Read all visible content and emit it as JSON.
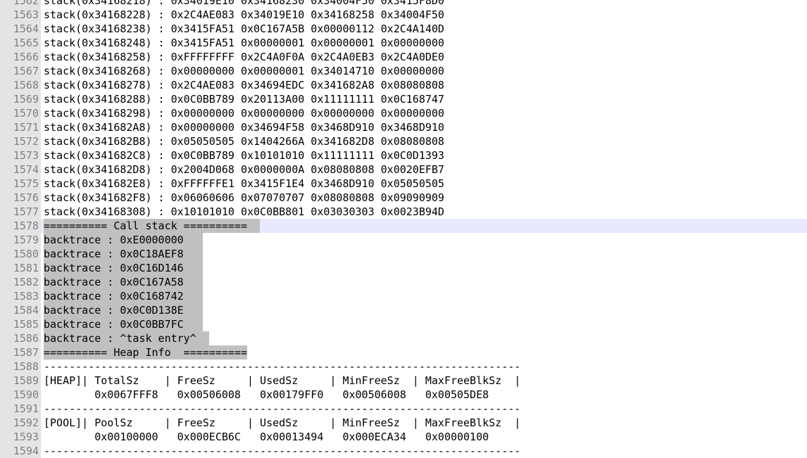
{
  "editor": {
    "current_line": 1578,
    "lines": [
      {
        "num": "1562",
        "text": "stack(0x34168218) : 0x34019E10 0x34168230 0x34004F50 0x3415F8D0",
        "selected": false
      },
      {
        "num": "1563",
        "text": "stack(0x34168228) : 0x2C4AE083 0x34019E10 0x34168258 0x34004F50",
        "selected": false
      },
      {
        "num": "1564",
        "text": "stack(0x34168238) : 0x3415FA51 0x0C167A5B 0x00000112 0x2C4A140D",
        "selected": false
      },
      {
        "num": "1565",
        "text": "stack(0x34168248) : 0x3415FA51 0x00000001 0x00000001 0x00000000",
        "selected": false
      },
      {
        "num": "1566",
        "text": "stack(0x34168258) : 0xFFFFFFFF 0x2C4A0F0A 0x2C4A0EB3 0x2C4A0DE0",
        "selected": false
      },
      {
        "num": "1567",
        "text": "stack(0x34168268) : 0x00000000 0x00000001 0x34014710 0x00000000",
        "selected": false
      },
      {
        "num": "1568",
        "text": "stack(0x34168278) : 0x2C4AE083 0x34694EDC 0x341682A8 0x08080808",
        "selected": false
      },
      {
        "num": "1569",
        "text": "stack(0x34168288) : 0x0C0BB789 0x20113A00 0x11111111 0x0C168747",
        "selected": false
      },
      {
        "num": "1570",
        "text": "stack(0x34168298) : 0x00000000 0x00000000 0x00000000 0x00000000",
        "selected": false
      },
      {
        "num": "1571",
        "text": "stack(0x341682A8) : 0x00000000 0x34694F58 0x3468D910 0x3468D910",
        "selected": false
      },
      {
        "num": "1572",
        "text": "stack(0x341682B8) : 0x05050505 0x1404266A 0x341682D8 0x08080808",
        "selected": false
      },
      {
        "num": "1573",
        "text": "stack(0x341682C8) : 0x0C0BB789 0x10101010 0x11111111 0x0C0D1393",
        "selected": false
      },
      {
        "num": "1574",
        "text": "stack(0x341682D8) : 0x2004D068 0x0000000A 0x08080808 0x0020EFB7",
        "selected": false
      },
      {
        "num": "1575",
        "text": "stack(0x341682E8) : 0xFFFFFFE1 0x3415F1E4 0x3468D910 0x05050505",
        "selected": false
      },
      {
        "num": "1576",
        "text": "stack(0x341682F8) : 0x06060606 0x07070707 0x08080808 0x09090909",
        "selected": false
      },
      {
        "num": "1577",
        "text": "stack(0x34168308) : 0x10101010 0x0C0BB801 0x03030303 0x0023B94D",
        "selected": false
      },
      {
        "num": "1578",
        "text": "========== Call stack ==========  ",
        "selected": true
      },
      {
        "num": "1579",
        "text": "backtrace : 0xE0000000   ",
        "selected": true
      },
      {
        "num": "1580",
        "text": "backtrace : 0x0C18AEF8   ",
        "selected": true
      },
      {
        "num": "1581",
        "text": "backtrace : 0x0C16D146   ",
        "selected": true
      },
      {
        "num": "1582",
        "text": "backtrace : 0x0C167A58   ",
        "selected": true
      },
      {
        "num": "1583",
        "text": "backtrace : 0x0C168742   ",
        "selected": true
      },
      {
        "num": "1584",
        "text": "backtrace : 0x0C0D138E   ",
        "selected": true
      },
      {
        "num": "1585",
        "text": "backtrace : 0x0C0BB7FC   ",
        "selected": true
      },
      {
        "num": "1586",
        "text": "backtrace : ^task entry^  ",
        "selected": true
      },
      {
        "num": "1587",
        "text": "========== Heap Info  ==========",
        "selected": true
      },
      {
        "num": "1588",
        "text": "---------------------------------------------------------------------------",
        "selected": false
      },
      {
        "num": "1589",
        "text": "[HEAP]| TotalSz    | FreeSz     | UsedSz     | MinFreeSz  | MaxFreeBlkSz  |",
        "selected": false
      },
      {
        "num": "1590",
        "text": "        0x0067FFF8   0x00506008   0x00179FF0   0x00506008   0x00505DE8",
        "selected": false
      },
      {
        "num": "1591",
        "text": "---------------------------------------------------------------------------",
        "selected": false
      },
      {
        "num": "1592",
        "text": "[POOL]| PoolSz     | FreeSz     | UsedSz     | MinFreeSz  | MaxFreeBlkSz  |",
        "selected": false
      },
      {
        "num": "1593",
        "text": "        0x00100000   0x000ECB6C   0x00013494   0x000ECA34   0x00000100",
        "selected": false
      },
      {
        "num": "1594",
        "text": "---------------------------------------------------------------------------",
        "selected": false
      }
    ]
  }
}
